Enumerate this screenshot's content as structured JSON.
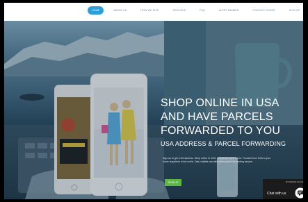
{
  "nav": {
    "items": [
      {
        "label": "HOME",
        "active": true
      },
      {
        "label": "ABOUT US",
        "active": false
      },
      {
        "label": "HOW WE SHIP",
        "active": false
      },
      {
        "label": "SERVICES",
        "active": false
      },
      {
        "label": "FAQ",
        "active": false
      },
      {
        "label": "ALERT BANNER",
        "active": false
      },
      {
        "label": "CONTACT ORDER",
        "active": false
      },
      {
        "label": "SIGN UP",
        "active": false
      }
    ]
  },
  "hero": {
    "headline": "SHOP ONLINE IN USA AND HAVE PARCELS FORWARDED TO YOU",
    "subheadline": "USA ADDRESS & PARCEL FORWARDING",
    "description": "Sign up to get a US address. Shop online in USA. Shipping to your home. Forward from USA to your home anywhere in the world. Fast, reliable and affordable parcel forwarding service.",
    "signup_label": "SIGN UP"
  },
  "chat": {
    "top_label": "BUSINESS HOURS",
    "label": "Chat with us",
    "icon": "chat-bubble-icon"
  },
  "colors": {
    "nav_active": "#2d9fd8",
    "signup_button": "#5fb546",
    "chat_background": "#1b1b1b"
  }
}
